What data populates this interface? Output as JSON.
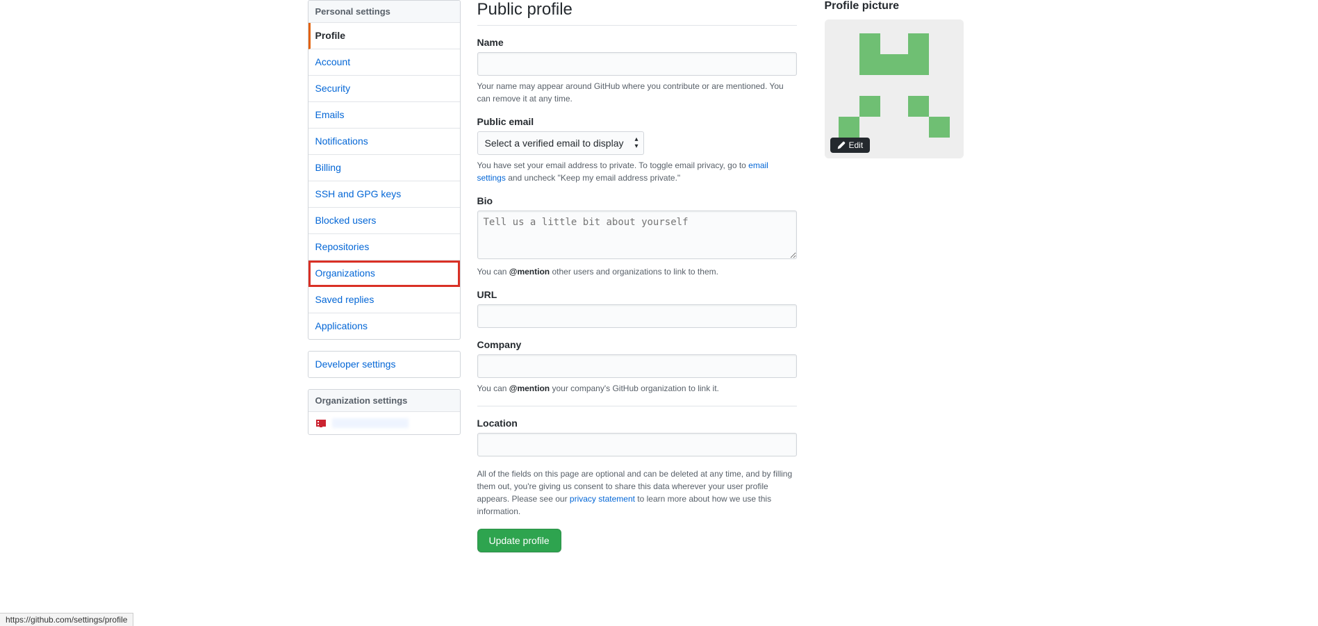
{
  "sidebar": {
    "personal_header": "Personal settings",
    "items": [
      {
        "label": "Profile"
      },
      {
        "label": "Account"
      },
      {
        "label": "Security"
      },
      {
        "label": "Emails"
      },
      {
        "label": "Notifications"
      },
      {
        "label": "Billing"
      },
      {
        "label": "SSH and GPG keys"
      },
      {
        "label": "Blocked users"
      },
      {
        "label": "Repositories"
      },
      {
        "label": "Organizations"
      },
      {
        "label": "Saved replies"
      },
      {
        "label": "Applications"
      }
    ],
    "developer_settings": "Developer settings",
    "org_header": "Organization settings"
  },
  "page": {
    "title": "Public profile",
    "name_label": "Name",
    "name_note": "Your name may appear around GitHub where you contribute or are mentioned. You can remove it at any time.",
    "email_label": "Public email",
    "email_select": "Select a verified email to display",
    "email_note_pre": "You have set your email address to private. To toggle email privacy, go to ",
    "email_note_link": "email settings",
    "email_note_post": " and uncheck \"Keep my email address private.\"",
    "bio_label": "Bio",
    "bio_placeholder": "Tell us a little bit about yourself",
    "bio_note_pre": "You can ",
    "bio_note_mention": "@mention",
    "bio_note_post": " other users and organizations to link to them.",
    "url_label": "URL",
    "company_label": "Company",
    "company_note_pre": "You can ",
    "company_note_mention": "@mention",
    "company_note_post": " your company's GitHub organization to link it.",
    "location_label": "Location",
    "disclaimer_pre": "All of the fields on this page are optional and can be deleted at any time, and by filling them out, you're giving us consent to share this data wherever your user profile appears. Please see our ",
    "disclaimer_link": "privacy statement",
    "disclaimer_post": " to learn more about how we use this information.",
    "update_btn": "Update profile"
  },
  "picture": {
    "heading": "Profile picture",
    "edit": "Edit"
  },
  "status": {
    "url": "https://github.com/settings/profile"
  }
}
